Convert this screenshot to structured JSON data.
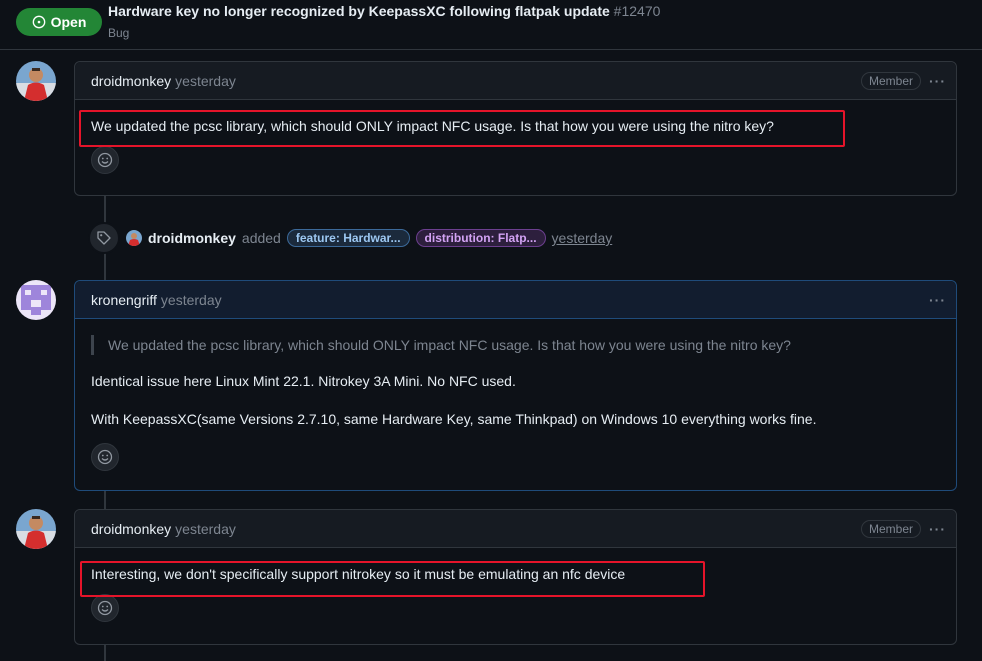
{
  "issue": {
    "state": "Open",
    "title": "Hardware key no longer recognized by KeepassXC following flatpak update",
    "number": "#12470",
    "type": "Bug"
  },
  "comments": [
    {
      "author": "droidmonkey",
      "time": "yesterday",
      "role": "Member",
      "more": "···",
      "body": "We updated the pcsc library, which should ONLY impact NFC usage. Is that how you were using the nitro key?"
    },
    {
      "author": "kronengriff",
      "time": "yesterday",
      "more": "···",
      "quote": "We updated the pcsc library, which should ONLY impact NFC usage. Is that how you were using the nitro key?",
      "paragraphs": [
        "Identical issue here Linux Mint 22.1. Nitrokey 3A Mini. No NFC used.",
        "With KeepassXC(same Versions 2.7.10, same Hardware Key, same Thinkpad) on Windows 10 everything works fine."
      ]
    },
    {
      "author": "droidmonkey",
      "time": "yesterday",
      "role": "Member",
      "more": "···",
      "body": "Interesting, we don't specifically support nitrokey so it must be emulating an nfc device"
    }
  ],
  "event": {
    "actor": "droidmonkey",
    "verb": "added",
    "labels": [
      "feature: Hardwar...",
      "distribution: Flatp..."
    ],
    "time": "yesterday"
  },
  "icons": {
    "state": "issue-opened-icon",
    "reaction": "smiley-icon",
    "event": "tag-icon",
    "more": "kebab-horizontal-icon"
  },
  "colors": {
    "open_badge": "#238636",
    "highlight_box": "#e5142a",
    "label_feature": "#9cc7f1",
    "label_distribution": "#d3a3f4"
  }
}
